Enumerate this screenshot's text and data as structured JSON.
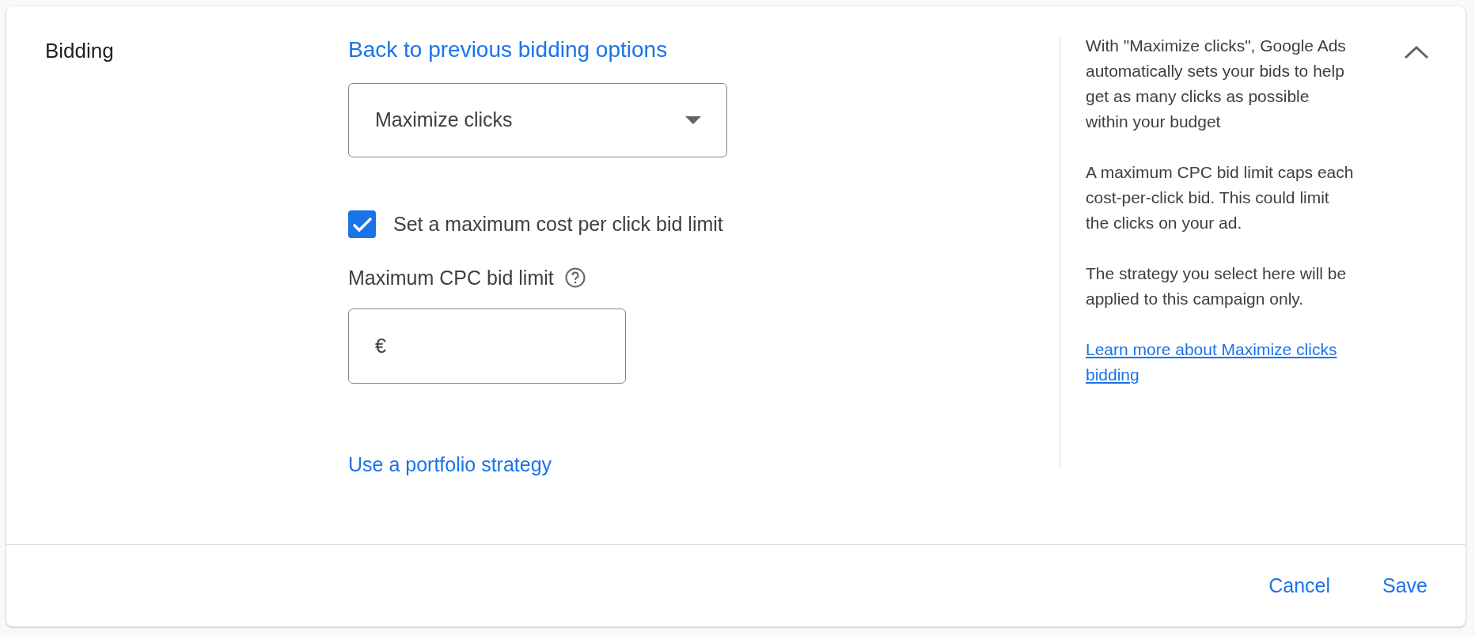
{
  "section_title": "Bidding",
  "back_link": "Back to previous bidding options",
  "strategy_dropdown": {
    "value": "Maximize clicks"
  },
  "max_cpc_checkbox": {
    "label": "Set a maximum cost per click bid limit",
    "checked": true
  },
  "max_cpc_field": {
    "label": "Maximum CPC bid limit",
    "prefix": "€"
  },
  "portfolio_link": "Use a portfolio strategy",
  "help_panel": {
    "paragraphs": [
      "With \"Maximize clicks\", Google Ads automatically sets your bids to help get as many clicks as possible within your budget",
      "A maximum CPC bid limit caps each cost-per-click bid. This could limit the clicks on your ad.",
      "The strategy you select here will be applied to this campaign only."
    ],
    "link": "Learn more about Maximize clicks bidding"
  },
  "expanded": true,
  "buttons": [
    "Cancel",
    "Save"
  ]
}
